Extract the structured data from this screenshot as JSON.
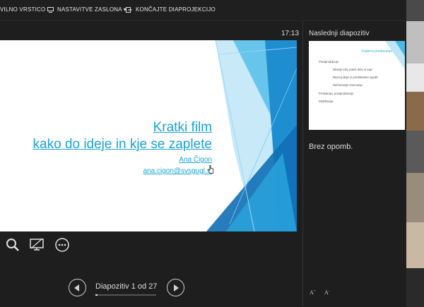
{
  "toolbar": {
    "items": [
      {
        "label": "VILNO VRSTICO"
      },
      {
        "label": "NASTAVITVE ZASLONA ▾"
      },
      {
        "label": "KONČAJTE DIAPROJEKCIJO"
      }
    ]
  },
  "presenter": {
    "clock": "17:13",
    "slide_counter": "Diapozitiv 1 od 27",
    "progress_fraction": 0.037
  },
  "slide": {
    "title_line1": "Kratki film",
    "title_line2": "kako do ideje in kje se zaplete",
    "author": "Ana Čigon",
    "email": "ana.cigon@svsgugl.si"
  },
  "next_panel": {
    "label": "Naslednji diapozitiv",
    "thumb_title": "Vsebina predavanja",
    "thumb_items": [
      "Predprodukcija",
      "Iskanje idej, potek dela in vaje",
      "Razvoj ideje in predstavitev zgodb",
      "Načrtovanje snemanja",
      "Produkcija, postprodukcija",
      "Distribucija"
    ],
    "notes": "Brez opomb."
  },
  "icons": {
    "search": "search-icon",
    "screen": "screen-icon",
    "more": "more-icon"
  },
  "colors": {
    "accent": "#1aa3d8",
    "background": "#1e1e1e"
  }
}
